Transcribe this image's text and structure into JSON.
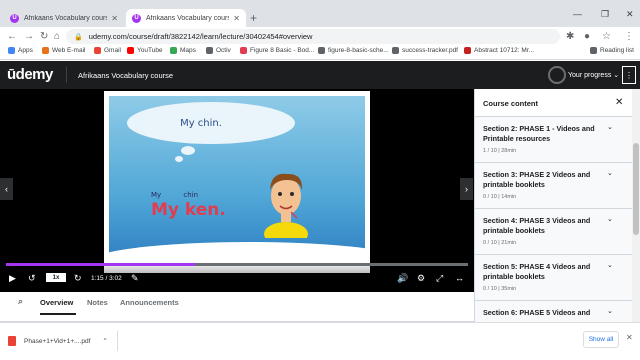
{
  "browser": {
    "tabs": [
      {
        "title": "Afrikaans Vocabulary course | Ud",
        "favicon": "U"
      },
      {
        "title": "Afrikaans Vocabulary course | Ud",
        "favicon": "U"
      }
    ],
    "url": "udemy.com/course/draft/3822142/learn/lecture/30402454#overview",
    "bookmarks": [
      {
        "label": "Apps",
        "color": "#4285f4"
      },
      {
        "label": "Web E-mail",
        "color": "#e8711a"
      },
      {
        "label": "Gmail",
        "color": "#ea4335"
      },
      {
        "label": "YouTube",
        "color": "#ff0000"
      },
      {
        "label": "Maps",
        "color": "#34a853"
      },
      {
        "label": "Octiv",
        "color": "#5f6368"
      },
      {
        "label": "Figure 8 Basic - Bod...",
        "color": "#e23c50"
      },
      {
        "label": "figure-8-basic-sche...",
        "color": "#5f6368"
      },
      {
        "label": "success-tracker.pdf",
        "color": "#5f6368"
      },
      {
        "label": "Abstract 10712: Mr...",
        "color": "#c5221f"
      }
    ],
    "reading_list": "Reading list"
  },
  "udemy": {
    "logo": "ūdemy",
    "course_title": "Afrikaans Vocabulary course",
    "your_progress": "Your progress"
  },
  "slide": {
    "bubble_text": "My chin.",
    "small_words": [
      "My",
      "chin"
    ],
    "big_text": "My ken."
  },
  "player": {
    "speed": "1x",
    "time": "1:15 / 3:02",
    "progress_fraction": 0.41
  },
  "sidebar": {
    "title": "Course content",
    "sections": [
      {
        "title": "Section 2: PHASE 1 - Videos and Printable resources",
        "meta": "1 / 10 | 28min"
      },
      {
        "title": "Section 3: PHASE 2 Videos and printable booklets",
        "meta": "0 / 10 | 14min"
      },
      {
        "title": "Section 4: PHASE 3 Videos and printable booklets",
        "meta": "0 / 10 | 21min"
      },
      {
        "title": "Section 5: PHASE 4 Videos and printable booklets",
        "meta": "0 / 10 | 35min"
      },
      {
        "title": "Section 6: PHASE 5 Videos and",
        "meta": ""
      }
    ]
  },
  "subtabs": {
    "overview": "Overview",
    "notes": "Notes",
    "announcements": "Announcements"
  },
  "downloads": {
    "file": "Phase+1+Vid+1+....pdf",
    "show_all": "Show all"
  }
}
